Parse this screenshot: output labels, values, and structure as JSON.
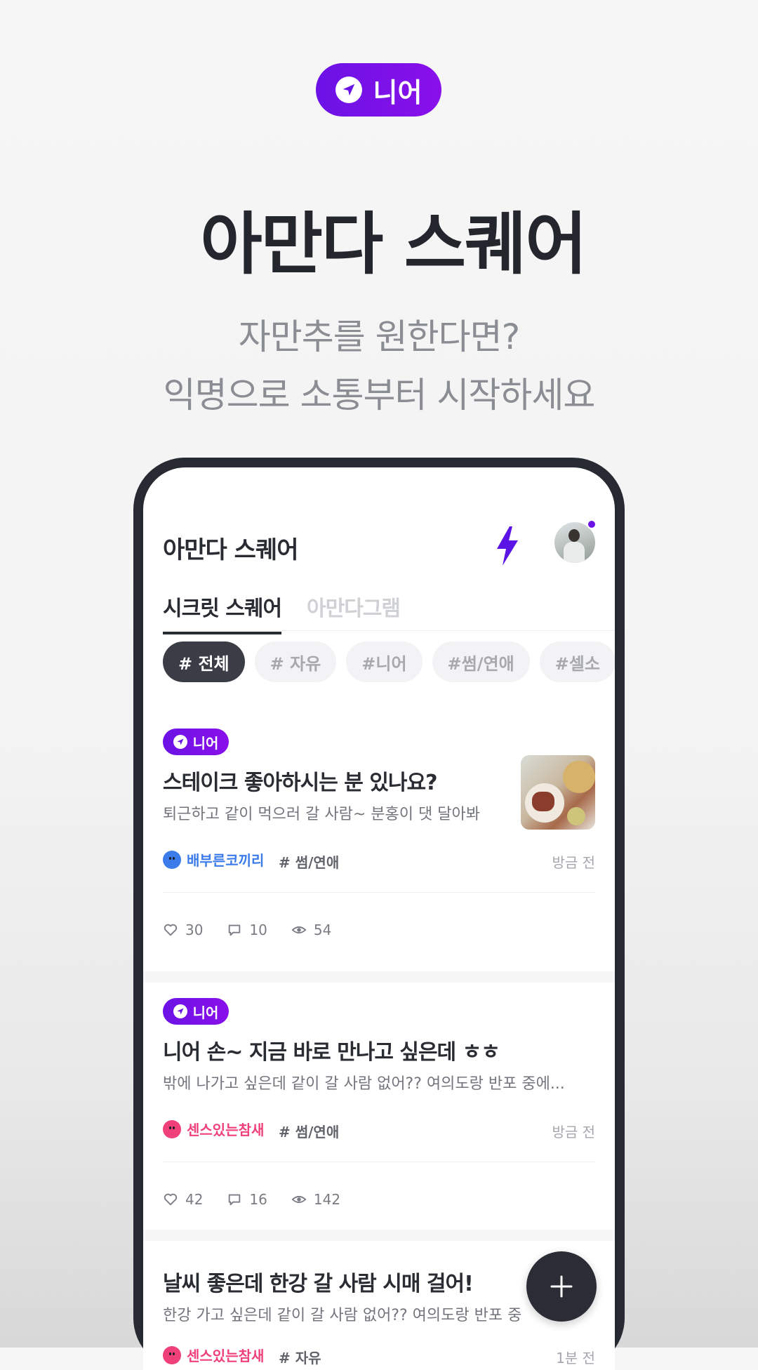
{
  "promo": {
    "pill_label": "니어",
    "title": "아만다 스퀘어",
    "subtitle_line1": "자만추를 원한다면?",
    "subtitle_line2": "익명으로 소통부터 시작하세요"
  },
  "app": {
    "title": "아만다 스퀘어",
    "tabs": [
      {
        "label": "시크릿 스퀘어",
        "active": true
      },
      {
        "label": "아만다그램",
        "active": false
      }
    ],
    "chips": [
      {
        "label": "# 전체",
        "active": true
      },
      {
        "label": "# 자유",
        "active": false
      },
      {
        "label": "#니어",
        "active": false
      },
      {
        "label": "#썸/연애",
        "active": false
      },
      {
        "label": "#셀소",
        "active": false
      },
      {
        "label": "#",
        "active": false
      }
    ],
    "accent_color": "#6B12E6",
    "posts": [
      {
        "badge": "니어",
        "title": "스테이크 좋아하시는 분 있나요?",
        "body": "퇴근하고 같이 먹으러 갈 사람~ 분홍이 댓 달아봐",
        "author": "배부른코끼리",
        "author_color": "#3B7BEA",
        "category": "# 썸/연애",
        "time": "방금 전",
        "likes": "30",
        "comments": "10",
        "views": "54",
        "has_thumbnail": true
      },
      {
        "badge": "니어",
        "title": "니어 손~ 지금 바로 만나고 싶은데 ㅎㅎ",
        "body": "밖에 나가고 싶은데 같이 갈 사람 없어?? 여의도랑 반포 중에...",
        "author": "센스있는참새",
        "author_color": "#F0407A",
        "category": "# 썸/연애",
        "time": "방금 전",
        "likes": "42",
        "comments": "16",
        "views": "142",
        "has_thumbnail": false
      },
      {
        "title": "날씨 좋은데 한강 갈 사람 시매 걸어!",
        "body": "한강 가고 싶은데 같이 갈 사람 없어?? 여의도랑 반포 중",
        "author": "센스있는참새",
        "author_color": "#F0407A",
        "category": "# 자유",
        "time": "1분 전"
      }
    ]
  }
}
